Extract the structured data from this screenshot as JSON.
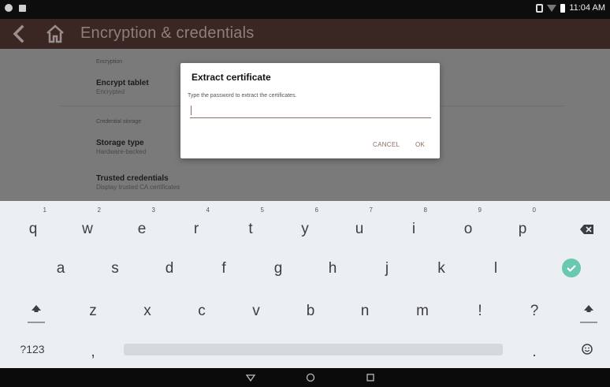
{
  "status_bar": {
    "time": "11:04 AM",
    "left_icons": [
      "notification-dot-icon",
      "notification-square-icon"
    ],
    "right_icons": [
      "vibrate-icon",
      "wifi-icon",
      "battery-icon"
    ]
  },
  "app_bar": {
    "title": "Encryption & credentials",
    "back_icon": "back-chevron-icon",
    "home_icon": "home-icon",
    "background": "#3a2723"
  },
  "settings": {
    "encryption_header": "Encryption",
    "encrypt_tablet": {
      "title": "Encrypt tablet",
      "summary": "Encrypted"
    },
    "credential_storage_header": "Credential storage",
    "storage_type": {
      "title": "Storage type",
      "summary": "Hardware-backed"
    },
    "trusted_credentials": {
      "title": "Trusted credentials",
      "summary": "Display trusted CA certificates"
    }
  },
  "dialog": {
    "title": "Extract certificate",
    "message": "Type the password to extract the certificates.",
    "password_value": "",
    "cancel_label": "CANCEL",
    "ok_label": "OK",
    "accent": "#8a6e62"
  },
  "keyboard": {
    "row1": [
      {
        "label": "q",
        "hint": "1"
      },
      {
        "label": "w",
        "hint": "2"
      },
      {
        "label": "e",
        "hint": "3"
      },
      {
        "label": "r",
        "hint": "4"
      },
      {
        "label": "t",
        "hint": "5"
      },
      {
        "label": "y",
        "hint": "6"
      },
      {
        "label": "u",
        "hint": "7"
      },
      {
        "label": "i",
        "hint": "8"
      },
      {
        "label": "o",
        "hint": "9"
      },
      {
        "label": "p",
        "hint": "0"
      }
    ],
    "row2": [
      "a",
      "s",
      "d",
      "f",
      "g",
      "h",
      "j",
      "k",
      "l"
    ],
    "row3": [
      "z",
      "x",
      "c",
      "v",
      "b",
      "n",
      "m",
      "!",
      "?"
    ],
    "symbols_label": "?123",
    "comma_label": ",",
    "period_label": ".",
    "backspace_icon": "backspace-icon",
    "enter_icon": "check-circle-icon",
    "shift_icon": "shift-arrow-icon",
    "emoji_icon": "emoji-icon",
    "enter_color": "#69c9b0"
  },
  "nav_bar": {
    "back_icon": "nav-back-triangle-icon",
    "home_icon": "nav-home-circle-icon",
    "recents_icon": "nav-recents-square-icon"
  }
}
